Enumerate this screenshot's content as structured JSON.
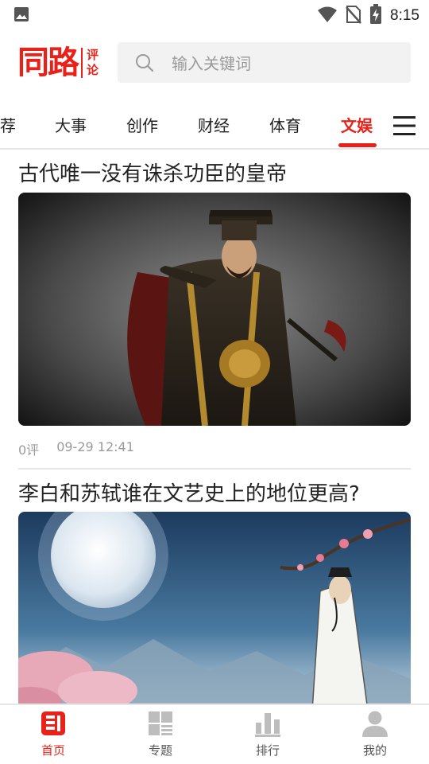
{
  "status_bar": {
    "time": "8:15",
    "icons": [
      "image-icon",
      "wifi-icon",
      "no-sim-icon",
      "battery-charging-icon"
    ]
  },
  "header": {
    "logo": {
      "main": "同路",
      "sub_top": "评",
      "sub_bottom": "论"
    },
    "search": {
      "placeholder": "输入关键词",
      "icon": "search-icon"
    }
  },
  "tabs": [
    {
      "label": "荐",
      "active": false
    },
    {
      "label": "大事",
      "active": false
    },
    {
      "label": "创作",
      "active": false
    },
    {
      "label": "财经",
      "active": false
    },
    {
      "label": "体育",
      "active": false
    },
    {
      "label": "文娱",
      "active": true
    }
  ],
  "articles": [
    {
      "title": "古代唯一没有诛杀功臣的皇帝",
      "comments": "0评",
      "time": "09-29 12:41"
    },
    {
      "title": "李白和苏轼谁在文艺史上的地位更高?"
    }
  ],
  "bottom_nav": [
    {
      "label": "首页",
      "icon": "home-icon",
      "active": true
    },
    {
      "label": "专题",
      "icon": "topics-icon",
      "active": false
    },
    {
      "label": "排行",
      "icon": "ranking-icon",
      "active": false
    },
    {
      "label": "我的",
      "icon": "profile-icon",
      "active": false
    }
  ],
  "colors": {
    "accent": "#e8211a",
    "muted": "#9a9a9a",
    "divider": "#e6e6e6"
  }
}
